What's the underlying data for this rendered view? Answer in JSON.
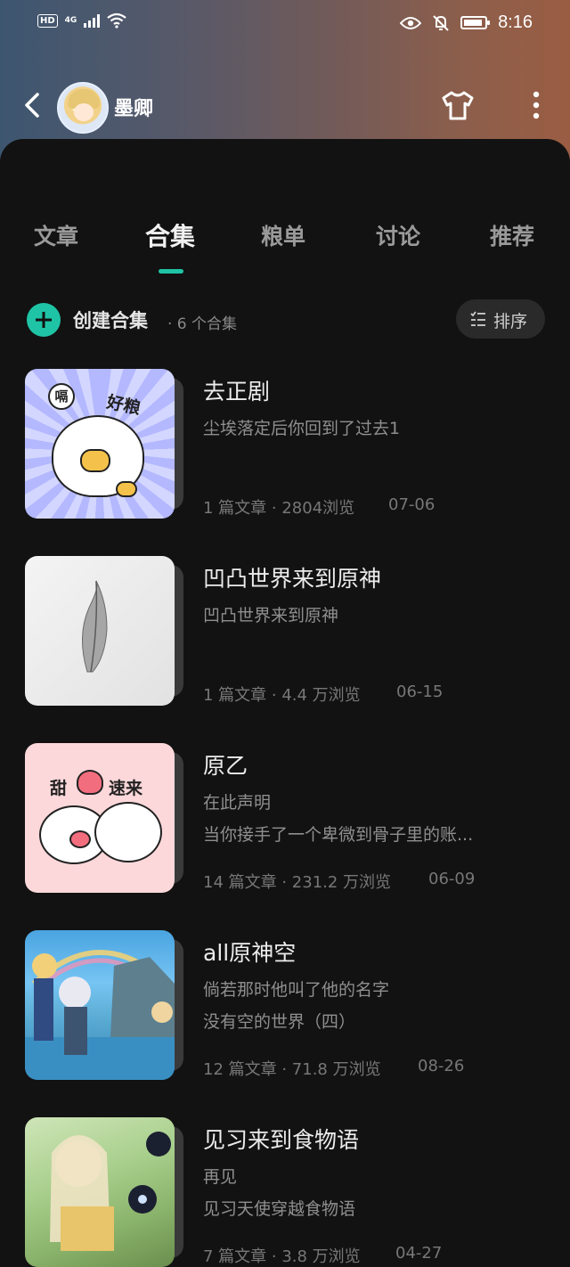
{
  "status_bar": {
    "hd": "HD",
    "network": "4G",
    "time": "8:16",
    "battery_level": 0.9
  },
  "header": {
    "username": "墨卿",
    "icons": [
      "back-arrow-icon",
      "avatar",
      "shirt-icon",
      "more-vertical-icon"
    ]
  },
  "tabs": [
    {
      "label": "文章",
      "active": false
    },
    {
      "label": "合集",
      "active": true
    },
    {
      "label": "粮单",
      "active": false
    },
    {
      "label": "讨论",
      "active": false
    },
    {
      "label": "推荐",
      "active": false
    }
  ],
  "actions": {
    "create_label": "创建合集",
    "count_text": "· 6 个合集",
    "sort_label": "排序"
  },
  "collections": [
    {
      "title": "去正剧",
      "desc1": "尘埃落定后你回到了过去1",
      "desc2": "",
      "meta": "1 篇文章 · 2804浏览",
      "date": "07-06",
      "thumb_text1": "嗝",
      "thumb_text2": "好粮"
    },
    {
      "title": "凹凸世界来到原神",
      "desc1": "凹凸世界来到原神",
      "desc2": "",
      "meta": "1 篇文章 · 4.4 万浏览",
      "date": "06-15"
    },
    {
      "title": "原乙",
      "desc1": "在此声明",
      "desc2": "当你接手了一个卑微到骨子里的账...",
      "meta": "14 篇文章 · 231.2 万浏览",
      "date": "06-09",
      "thumb_text1": "甜",
      "thumb_text2": "速来"
    },
    {
      "title": "all原神空",
      "desc1": "倘若那时他叫了他的名字",
      "desc2": "没有空的世界（四）",
      "meta": "12 篇文章 · 71.8 万浏览",
      "date": "08-26"
    },
    {
      "title": "见习来到食物语",
      "desc1": "再见",
      "desc2": "见习天使穿越食物语",
      "meta": "7 篇文章 · 3.8 万浏览",
      "date": "04-27"
    }
  ]
}
